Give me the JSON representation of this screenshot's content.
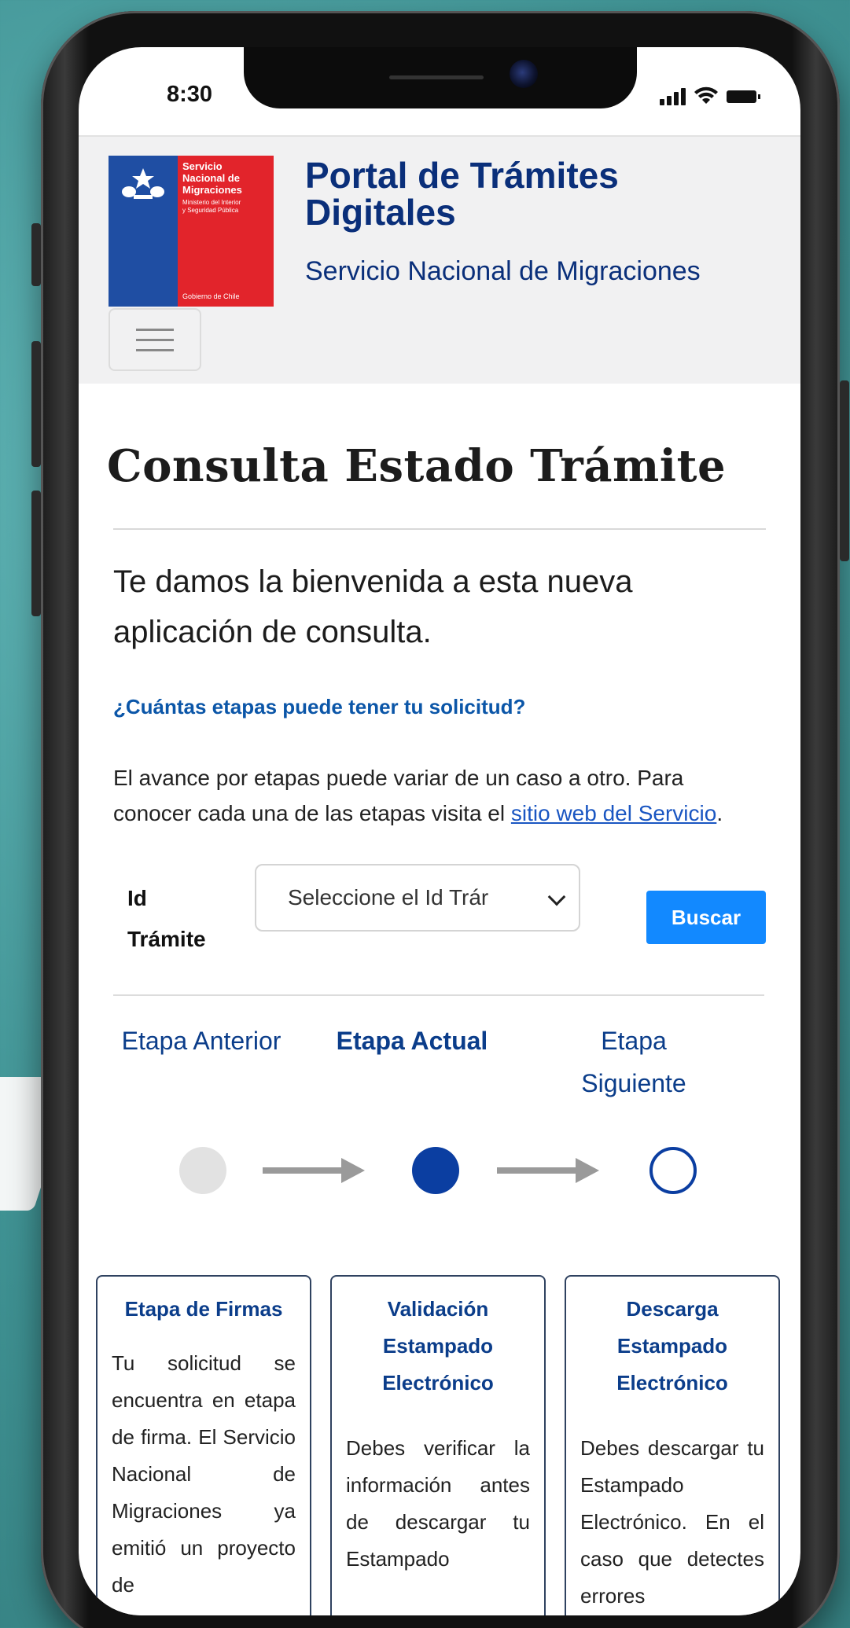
{
  "status_bar": {
    "time": "8:30"
  },
  "header": {
    "logo": {
      "line1": "Servicio",
      "line2": "Nacional de",
      "line3": "Migraciones",
      "ministry1": "Ministerio del Interior",
      "ministry2": "y Seguridad Pública",
      "gov": "Gobierno de Chile"
    },
    "title_line1": "Portal de Trámites",
    "title_line2": "Digitales",
    "subtitle": "Servicio Nacional de Migraciones"
  },
  "main": {
    "page_title": "Consulta Estado Trámite",
    "welcome": "Te damos la bienvenida a esta nueva aplicación de consulta.",
    "question": "¿Cuántas etapas puede tener tu solicitud?",
    "info_text_1": "El avance por etapas puede variar de un caso a otro. Para conocer cada una de las etapas visita el ",
    "info_link": "sitio web del Servicio",
    "info_text_2": ".",
    "id_label_1": "Id",
    "id_label_2": "Trámite",
    "select_value": "Seleccione el Id Trár",
    "search_button": "Buscar"
  },
  "stages": {
    "previous_label": "Etapa Anterior",
    "current_label": "Etapa Actual",
    "next_label_1": "Etapa",
    "next_label_2": "Siguiente"
  },
  "cards": [
    {
      "title": "Etapa de Firmas",
      "body": "Tu solicitud se encuentra en etapa de firma. El Servicio Nacional de Migraciones ya emitió un proyecto de"
    },
    {
      "title": "Validación Estampado Electrónico",
      "body": "Debes verificar la información antes de descargar tu Estampado"
    },
    {
      "title": "Descarga Estampado Electrónico",
      "body": "Debes descargar tu Estampado Electrónico. En el caso que detectes errores"
    }
  ],
  "colors": {
    "brand_navy": "#0a2f7a",
    "link_blue": "#0b56a8",
    "button_blue": "#1289ff",
    "current_stage": "#0b3ea1",
    "logo_red": "#e2242b",
    "logo_blue": "#1f4ea3"
  }
}
